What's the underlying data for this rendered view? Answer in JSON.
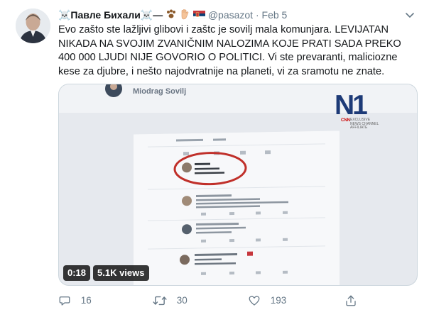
{
  "tweet": {
    "display_name": "☠️Павле Бихали☠️—",
    "handle": "@pasazot",
    "separator": "·",
    "date": "Feb 5",
    "text": "Evo zašto ste lažljivi glibovi i zaštc je sovilj mala komunjara. LEVIJATAN NIKADA NA SVOJIM ZVANIČNIM NALOZIMA KOJE PRATI SADA PREKO 400 000 LJUDI NIJE GOVORIO O POLITICI. Vi ste prevaranti, maliciozne kese za djubre, i nešto najodvratnije na planeti, vi za sramotu ne znate."
  },
  "media": {
    "video_title_name": "Miodrag Sovilj",
    "logo_text": "N1",
    "logo_cnn": "CNN",
    "logo_sub": "EXCLUSIVE NEWS CHANNEL AFFILIATE",
    "duration": "0:18",
    "views": "5.1K views"
  },
  "actions": {
    "replies": "16",
    "retweets": "30",
    "likes": "193"
  },
  "icons": {
    "caret": "chevron-down-icon",
    "reply": "reply-icon",
    "retweet": "retweet-icon",
    "like": "heart-icon",
    "share": "share-icon"
  },
  "colors": {
    "secondary_text": "#657786",
    "n1_blue": "#1d3a77"
  }
}
